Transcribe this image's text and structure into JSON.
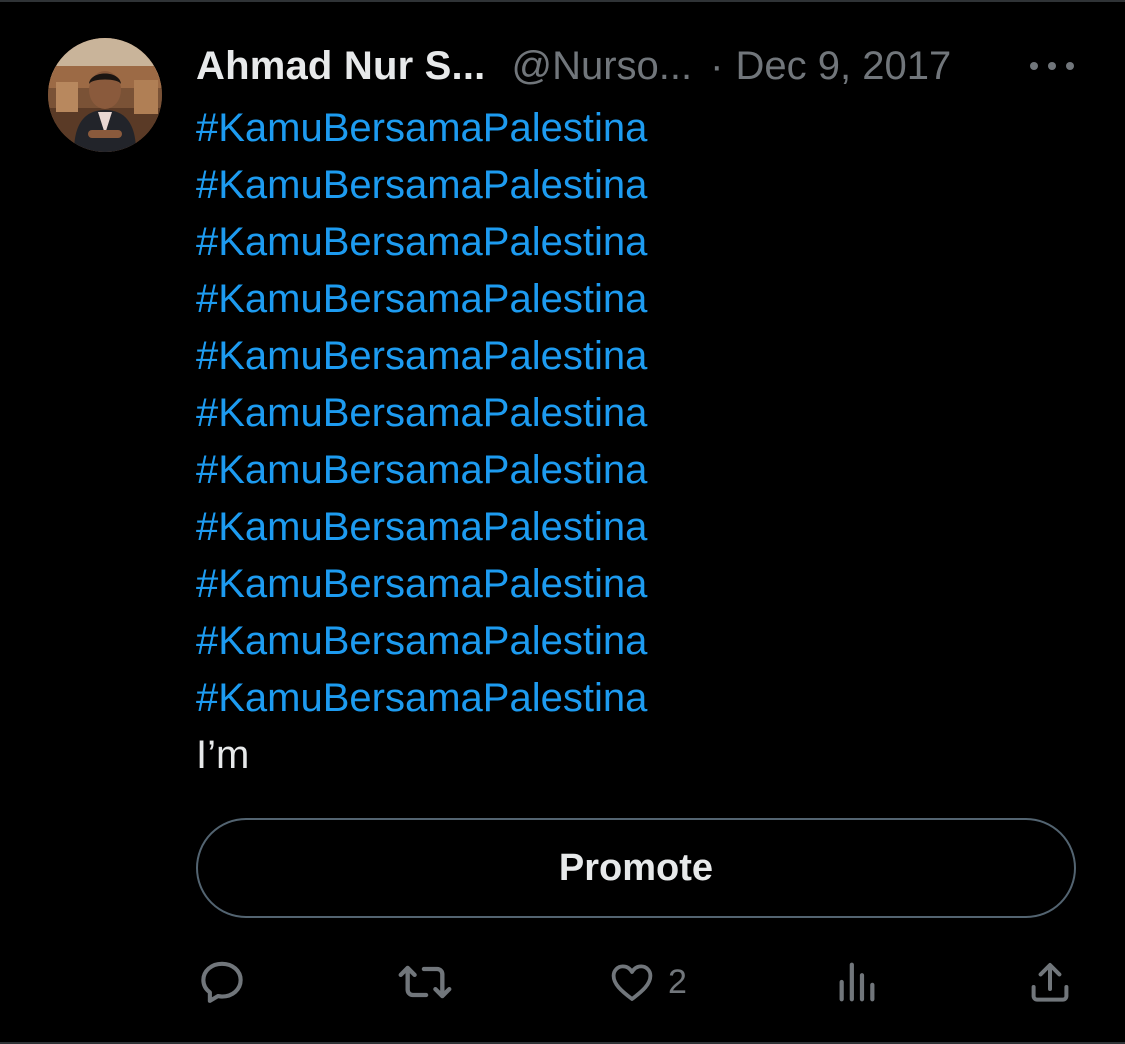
{
  "tweet": {
    "author": {
      "display_name": "Ahmad Nur S...",
      "handle": "@Nurso...",
      "separator": "·",
      "date": "Dec 9, 2017"
    },
    "hashtags": [
      "#KamuBersamaPalestina",
      "#KamuBersamaPalestina",
      "#KamuBersamaPalestina",
      "#KamuBersamaPalestina",
      "#KamuBersamaPalestina",
      "#KamuBersamaPalestina",
      "#KamuBersamaPalestina",
      "#KamuBersamaPalestina",
      "#KamuBersamaPalestina",
      "#KamuBersamaPalestina",
      "#KamuBersamaPalestina"
    ],
    "text": "I’m",
    "promote_label": "Promote",
    "actions": {
      "reply_icon": "reply-icon",
      "retweet_icon": "retweet-icon",
      "like_icon": "heart-icon",
      "like_count": "2",
      "views_icon": "analytics-icon",
      "share_icon": "share-icon",
      "more_icon": "more-dots-icon"
    }
  },
  "colors": {
    "background": "#000000",
    "primary_text": "#e7e9ea",
    "secondary_text": "#71767b",
    "link": "#1d9bf0",
    "border": "#536471"
  }
}
